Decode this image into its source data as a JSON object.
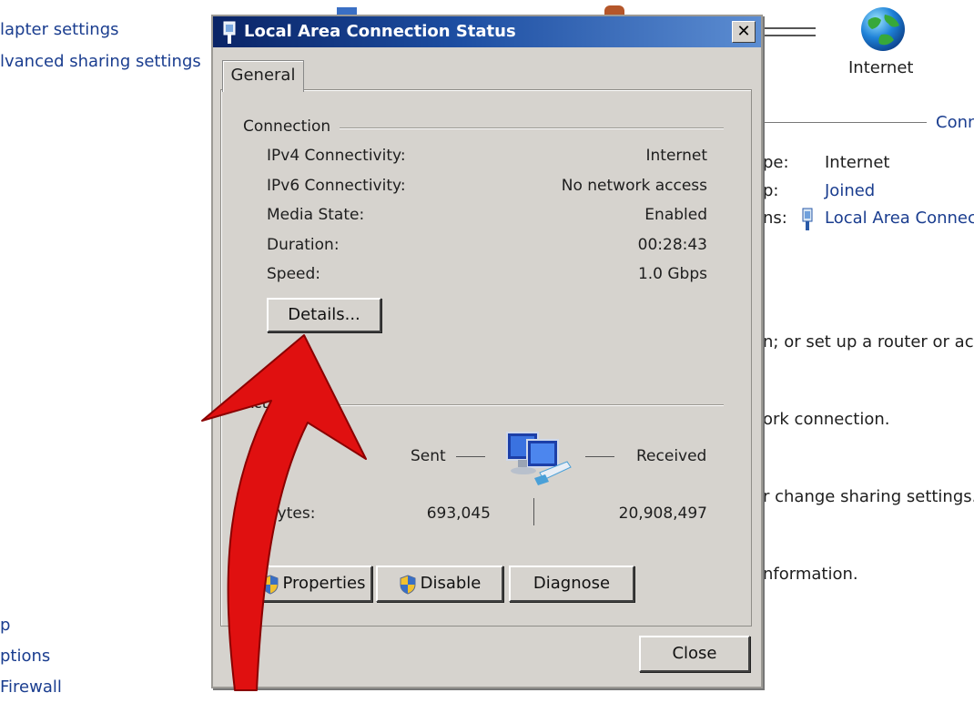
{
  "background": {
    "left_links": [
      "lapter settings",
      "lvanced sharing settings"
    ],
    "left_bottom_links": [
      "p",
      "ptions",
      "Firewall"
    ],
    "network_label": "Internet",
    "header_right": "Conn",
    "type_label": "pe:",
    "type_value": "Internet",
    "group_label": "p:",
    "group_value": "Joined",
    "connections_label": "ns:",
    "connections_value": "Local Area Connectio",
    "line1": "n; or set up a router or acces",
    "line2": "ork connection.",
    "line3": "r change sharing settings.",
    "line4": "nformation."
  },
  "dialog": {
    "title": "Local Area Connection Status",
    "close_glyph": "✕",
    "tab_general": "General",
    "connection_header": "Connection",
    "rows": [
      {
        "label": "IPv4 Connectivity:",
        "value": "Internet"
      },
      {
        "label": "IPv6 Connectivity:",
        "value": "No network access"
      },
      {
        "label": "Media State:",
        "value": "Enabled"
      },
      {
        "label": "Duration:",
        "value": "00:28:43"
      },
      {
        "label": "Speed:",
        "value": "1.0 Gbps"
      }
    ],
    "details_button": "Details...",
    "activity_header_partial": "Act",
    "sent_label": "Sent",
    "received_label": "Received",
    "bytes_label": "Bytes:",
    "bytes_sent": "693,045",
    "bytes_received": "20,908,497",
    "properties_button": "Properties",
    "disable_button": "Disable",
    "diagnose_button": "Diagnose",
    "close_button": "Close"
  },
  "colors": {
    "link": "#1a3d8f",
    "dialog_face": "#d6d3ce",
    "title_gradient_start": "#0a2466",
    "title_gradient_end": "#5c8dd2",
    "annotation_arrow": "#e01010"
  },
  "icons": [
    "network-adapter-icon",
    "globe-icon",
    "computers-network-icon",
    "uac-shield-icon",
    "close-icon",
    "annotation-arrow"
  ]
}
